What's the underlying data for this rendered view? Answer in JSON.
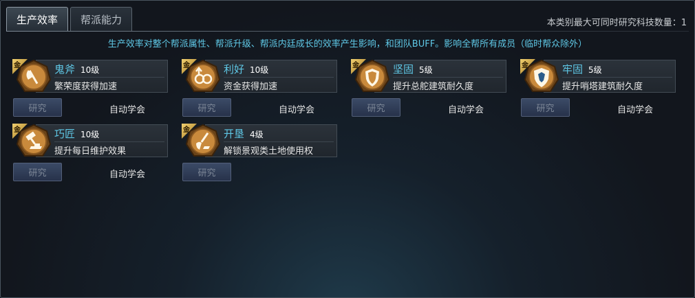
{
  "tabs": [
    {
      "label": "生产效率",
      "active": true
    },
    {
      "label": "帮派能力",
      "active": false
    }
  ],
  "capacity_text": "本类别最大可同时研究科技数量：1",
  "description": "生产效率对整个帮派属性、帮派升级、帮派内廷成长的效率产生影响，和团队BUFF。影响全帮所有成员（临时帮众除外）",
  "techs": [
    {
      "name": "鬼斧",
      "level": "10级",
      "effect": "繁荣度获得加速",
      "badge": "金",
      "button": "研究",
      "status": "自动学会",
      "icon": "axe-icon"
    },
    {
      "name": "利好",
      "level": "10级",
      "effect": "资金获得加速",
      "badge": "金",
      "button": "研究",
      "status": "自动学会",
      "icon": "coins-icon"
    },
    {
      "name": "坚固",
      "level": "5级",
      "effect": "提升总舵建筑耐久度",
      "badge": "金",
      "button": "研究",
      "status": "自动学会",
      "icon": "shield-icon"
    },
    {
      "name": "牢固",
      "level": "5级",
      "effect": "提升哨塔建筑耐久度",
      "badge": "金",
      "button": "研究",
      "status": "自动学会",
      "icon": "crest-icon"
    },
    {
      "name": "巧匠",
      "level": "10级",
      "effect": "提升每日维护效果",
      "badge": "金",
      "button": "研究",
      "status": "自动学会",
      "icon": "hammer-icon"
    },
    {
      "name": "开垦",
      "level": "4级",
      "effect": "解锁景观类土地使用权",
      "badge": "金",
      "button": "研究",
      "status": "",
      "icon": "shovel-icon"
    }
  ],
  "colors": {
    "accent": "#5fc8e6",
    "badge": "#e0b550",
    "icon_orange": "#c98a3c",
    "icon_bronze": "#6a4318"
  }
}
